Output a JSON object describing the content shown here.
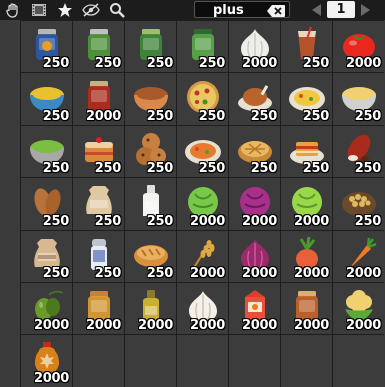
{
  "toolbar": {
    "icons": [
      "hand-icon",
      "film-icon",
      "star-icon",
      "hidden-eye-icon",
      "magnifier-icon"
    ],
    "search_value": "plus",
    "page_number": "1"
  },
  "items": [
    {
      "name": "canned-food",
      "count": "250"
    },
    {
      "name": "pickled-vegetables-jar",
      "count": "250"
    },
    {
      "name": "pickle-jar",
      "count": "250"
    },
    {
      "name": "green-jar",
      "count": "250"
    },
    {
      "name": "garlic",
      "count": "2000"
    },
    {
      "name": "juice-glass",
      "count": "250"
    },
    {
      "name": "tomato",
      "count": "2000"
    },
    {
      "name": "soup-bowl",
      "count": "250"
    },
    {
      "name": "jam-jar",
      "count": "2000"
    },
    {
      "name": "stew-bowl",
      "count": "250"
    },
    {
      "name": "pizza-plate",
      "count": "250"
    },
    {
      "name": "roast-meat",
      "count": "250"
    },
    {
      "name": "omelette-plate",
      "count": "250"
    },
    {
      "name": "noodle-bowl",
      "count": "250"
    },
    {
      "name": "salad-bowl",
      "count": "250"
    },
    {
      "name": "cake",
      "count": "250"
    },
    {
      "name": "cookies",
      "count": "250"
    },
    {
      "name": "fruit-plate",
      "count": "250"
    },
    {
      "name": "pie",
      "count": "250"
    },
    {
      "name": "lasagna",
      "count": "250"
    },
    {
      "name": "cocoa-pod",
      "count": "250"
    },
    {
      "name": "almond",
      "count": "250"
    },
    {
      "name": "flour-sack",
      "count": "250"
    },
    {
      "name": "milk-bottle",
      "count": "250"
    },
    {
      "name": "cabbage",
      "count": "2000"
    },
    {
      "name": "red-cabbage",
      "count": "2000"
    },
    {
      "name": "lettuce",
      "count": "2000"
    },
    {
      "name": "chickpeas-bowl",
      "count": "250"
    },
    {
      "name": "sugar-sack",
      "count": "250"
    },
    {
      "name": "salt-shaker",
      "count": "250"
    },
    {
      "name": "bread",
      "count": "250"
    },
    {
      "name": "wheat",
      "count": "2000"
    },
    {
      "name": "onion",
      "count": "2000"
    },
    {
      "name": "radish",
      "count": "2000"
    },
    {
      "name": "carrot",
      "count": "2000"
    },
    {
      "name": "olive",
      "count": "2000"
    },
    {
      "name": "honey-jar",
      "count": "2000"
    },
    {
      "name": "oil-bottle",
      "count": "2000"
    },
    {
      "name": "garlic-bulb",
      "count": "2000"
    },
    {
      "name": "juice-carton",
      "count": "2000"
    },
    {
      "name": "spice-jar",
      "count": "2000"
    },
    {
      "name": "cauliflower",
      "count": "2000"
    },
    {
      "name": "maple-syrup-bottle",
      "count": "2000"
    }
  ],
  "empty_slots": 6,
  "colors": {
    "toolbar": "#1c1c1c",
    "slot": "#3c3c3c",
    "slot_border": "#1e1e1e",
    "count_text": "#ffffff"
  }
}
